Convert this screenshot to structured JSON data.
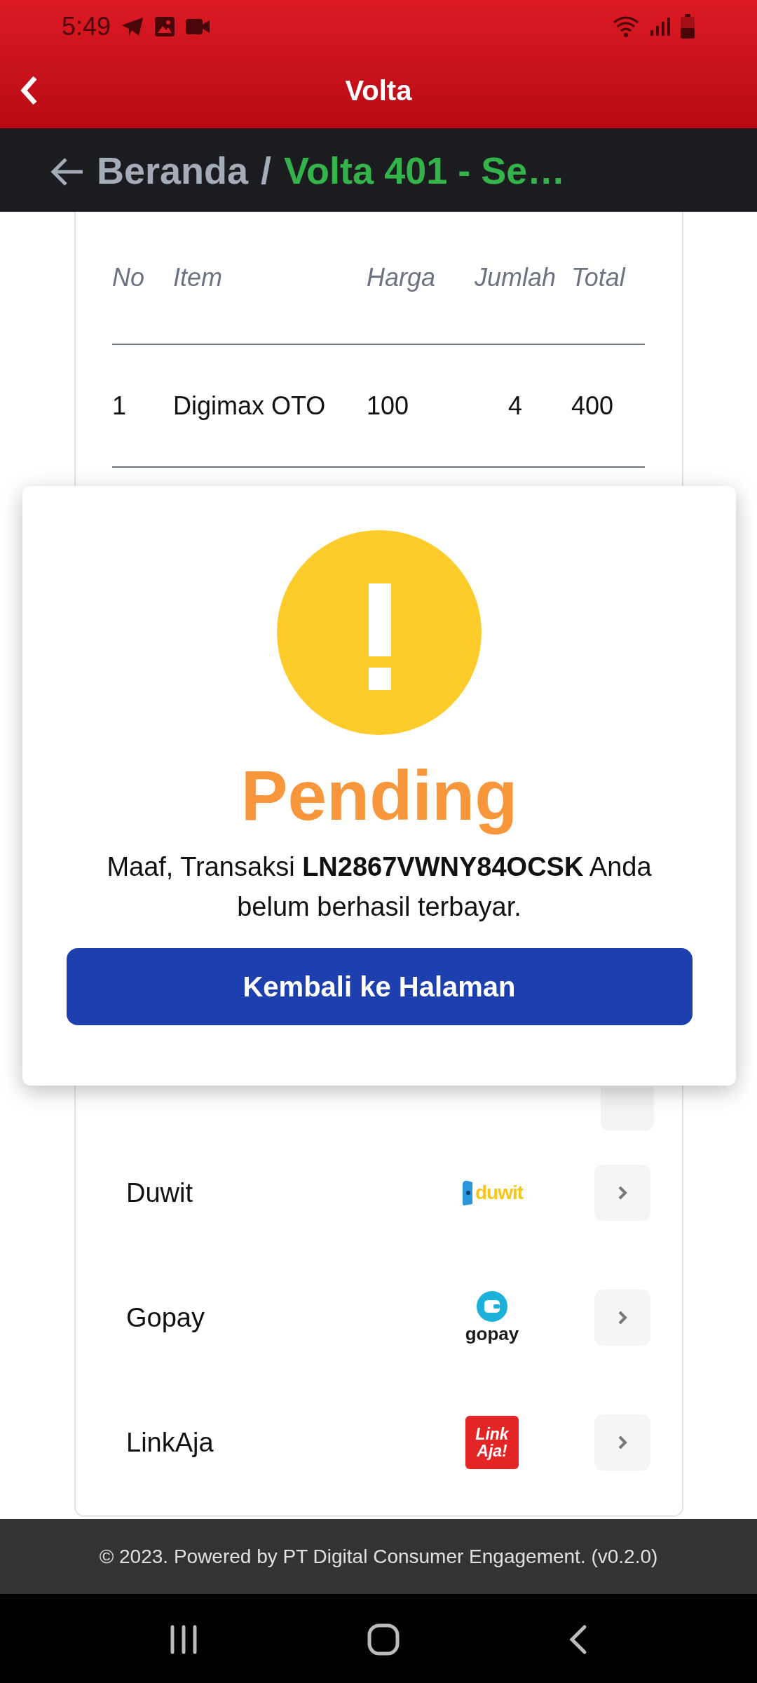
{
  "status_bar": {
    "time": "5:49"
  },
  "app_bar": {
    "title": "Volta"
  },
  "breadcrumb": {
    "items": [
      {
        "label": "Beranda",
        "selected": false
      },
      {
        "label": "Volta 401 - Se…",
        "selected": true
      }
    ],
    "separator": "/"
  },
  "table": {
    "columns": [
      "No",
      "Item",
      "Harga",
      "Jumlah",
      "Total"
    ],
    "rows": [
      [
        "1",
        "Digimax OTO",
        "100",
        "4",
        "400"
      ]
    ]
  },
  "payment_methods": [
    {
      "name": "Duwit",
      "kind": "duwit",
      "logo_text": "duwit"
    },
    {
      "name": "Gopay",
      "kind": "gopay",
      "logo_text": "gopay"
    },
    {
      "name": "LinkAja",
      "kind": "linkaja",
      "logo_text": "Link\nAja!"
    }
  ],
  "dialog": {
    "status": "Pending",
    "message": "Maaf, Transaksi **LN2867VWNY84OCSK** Anda belum berhasil terbayar.",
    "button": "Kembali ke Halaman"
  },
  "footer": {
    "text": "© 2023. Powered by PT Digital Consumer Engagement. (v0.2.0)"
  }
}
